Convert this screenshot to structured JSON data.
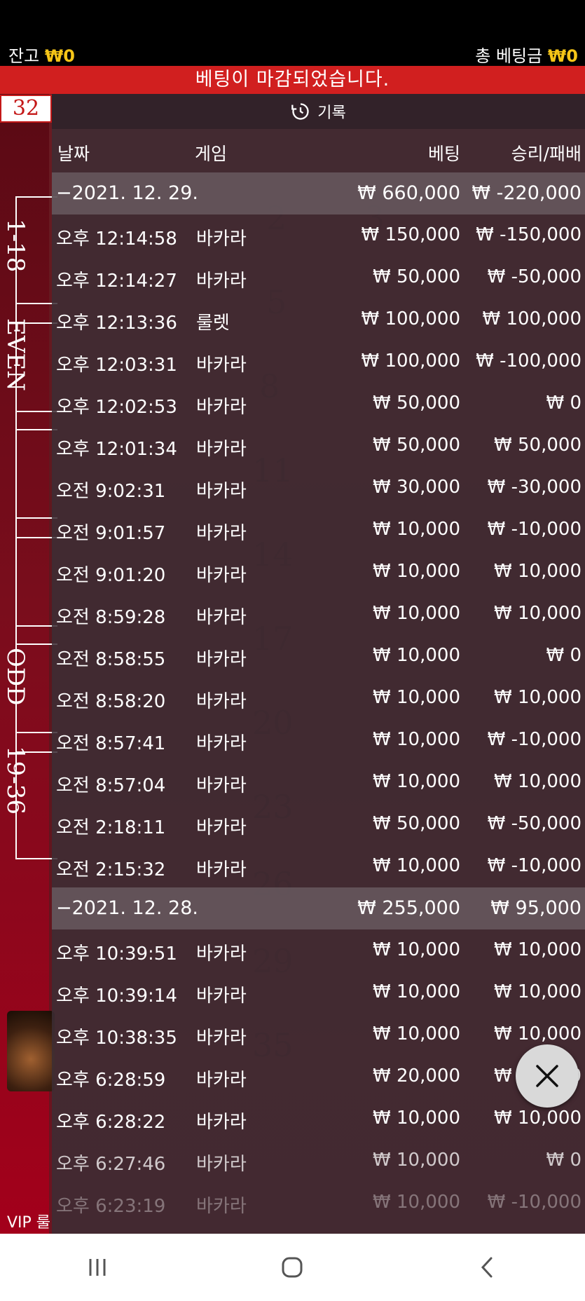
{
  "header": {
    "balance_label": "잔고",
    "balance_value": "₩0",
    "total_bet_label": "총 베팅금",
    "total_bet_value": "₩0"
  },
  "banner": {
    "text": "베팅이 마감되었습니다."
  },
  "game": {
    "last_number": "32",
    "side_labels": [
      "1-18",
      "EVEN",
      "ODD",
      "19-36"
    ],
    "vip_label": "VIP 룰"
  },
  "history": {
    "title": "기록",
    "columns": {
      "date": "날짜",
      "game": "게임",
      "bet": "베팅",
      "result": "승리/패배"
    },
    "groups": [
      {
        "date": "−2021. 12. 29.",
        "total_bet": "₩ 660,000",
        "total_result": "₩ -220,000",
        "rows": [
          {
            "time": "오후 12:14:58",
            "game": "바카라",
            "bet": "₩ 150,000",
            "result": "₩ -150,000"
          },
          {
            "time": "오후 12:14:27",
            "game": "바카라",
            "bet": "₩ 50,000",
            "result": "₩ -50,000"
          },
          {
            "time": "오후 12:13:36",
            "game": "룰렛",
            "bet": "₩ 100,000",
            "result": "₩ 100,000"
          },
          {
            "time": "오후 12:03:31",
            "game": "바카라",
            "bet": "₩ 100,000",
            "result": "₩ -100,000"
          },
          {
            "time": "오후 12:02:53",
            "game": "바카라",
            "bet": "₩ 50,000",
            "result": "₩ 0"
          },
          {
            "time": "오후 12:01:34",
            "game": "바카라",
            "bet": "₩ 50,000",
            "result": "₩ 50,000"
          },
          {
            "time": "오전 9:02:31",
            "game": "바카라",
            "bet": "₩ 30,000",
            "result": "₩ -30,000"
          },
          {
            "time": "오전 9:01:57",
            "game": "바카라",
            "bet": "₩ 10,000",
            "result": "₩ -10,000"
          },
          {
            "time": "오전 9:01:20",
            "game": "바카라",
            "bet": "₩ 10,000",
            "result": "₩ 10,000"
          },
          {
            "time": "오전 8:59:28",
            "game": "바카라",
            "bet": "₩ 10,000",
            "result": "₩ 10,000"
          },
          {
            "time": "오전 8:58:55",
            "game": "바카라",
            "bet": "₩ 10,000",
            "result": "₩ 0"
          },
          {
            "time": "오전 8:58:20",
            "game": "바카라",
            "bet": "₩ 10,000",
            "result": "₩ 10,000"
          },
          {
            "time": "오전 8:57:41",
            "game": "바카라",
            "bet": "₩ 10,000",
            "result": "₩ -10,000"
          },
          {
            "time": "오전 8:57:04",
            "game": "바카라",
            "bet": "₩ 10,000",
            "result": "₩ 10,000"
          },
          {
            "time": "오전 2:18:11",
            "game": "바카라",
            "bet": "₩ 50,000",
            "result": "₩ -50,000"
          },
          {
            "time": "오전 2:15:32",
            "game": "바카라",
            "bet": "₩ 10,000",
            "result": "₩ -10,000"
          }
        ]
      },
      {
        "date": "−2021. 12. 28.",
        "total_bet": "₩ 255,000",
        "total_result": "₩ 95,000",
        "rows": [
          {
            "time": "오후 10:39:51",
            "game": "바카라",
            "bet": "₩ 10,000",
            "result": "₩ 10,000"
          },
          {
            "time": "오후 10:39:14",
            "game": "바카라",
            "bet": "₩ 10,000",
            "result": "₩ 10,000"
          },
          {
            "time": "오후 10:38:35",
            "game": "바카라",
            "bet": "₩ 10,000",
            "result": "₩ 10,000"
          },
          {
            "time": "오후 6:28:59",
            "game": "바카라",
            "bet": "₩ 20,000",
            "result": "₩ 20,000"
          },
          {
            "time": "오후 6:28:22",
            "game": "바카라",
            "bet": "₩ 10,000",
            "result": "₩ 10,000"
          },
          {
            "time": "오후 6:27:46",
            "game": "바카라",
            "bet": "₩ 10,000",
            "result": "₩ 0"
          },
          {
            "time": "오후 6:23:19",
            "game": "바카라",
            "bet": "₩ 10,000",
            "result": "₩ -10,000"
          }
        ]
      }
    ]
  }
}
